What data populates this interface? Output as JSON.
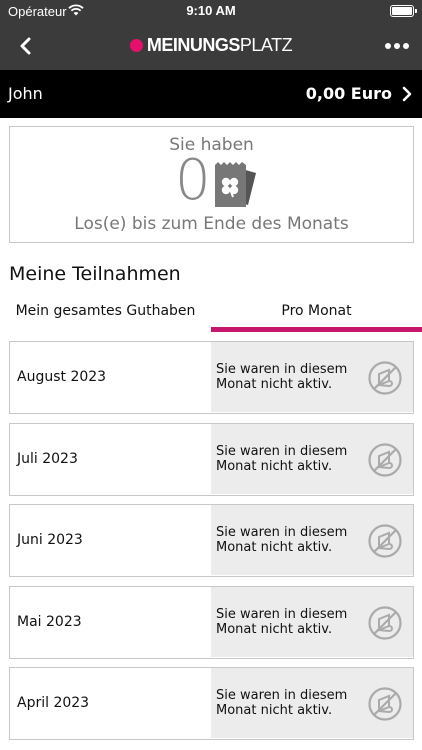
{
  "status_bar": {
    "carrier": "Opérateur",
    "time": "9:10 AM"
  },
  "nav": {
    "logo_bold": "MEINUNGS",
    "logo_light": "PLATZ",
    "back_icon": "chevron-left-icon",
    "more_icon": "more-dots-icon"
  },
  "user": {
    "name": "John",
    "balance": "0,00 Euro"
  },
  "tickets": {
    "intro": "Sie haben",
    "count": "0",
    "outro": "Los(e) bis zum Ende des Monats"
  },
  "section_title": "Meine Teilnahmen",
  "tabs": [
    {
      "label": "Mein gesamtes Guthaben",
      "active": false
    },
    {
      "label": "Pro Monat",
      "active": true
    }
  ],
  "colors": {
    "accent": "#c7176d",
    "brand_dot": "#e5106e",
    "header_bg": "#3b3b3b"
  },
  "months": [
    {
      "label": "August 2023",
      "status": "Sie waren in diesem Monat nicht aktiv."
    },
    {
      "label": "Juli 2023",
      "status": "Sie waren in diesem Monat nicht aktiv."
    },
    {
      "label": "Juni 2023",
      "status": "Sie waren in diesem Monat nicht aktiv."
    },
    {
      "label": "Mai 2023",
      "status": "Sie waren in diesem Monat nicht aktiv."
    },
    {
      "label": "April 2023",
      "status": "Sie waren in diesem Monat nicht aktiv."
    }
  ]
}
